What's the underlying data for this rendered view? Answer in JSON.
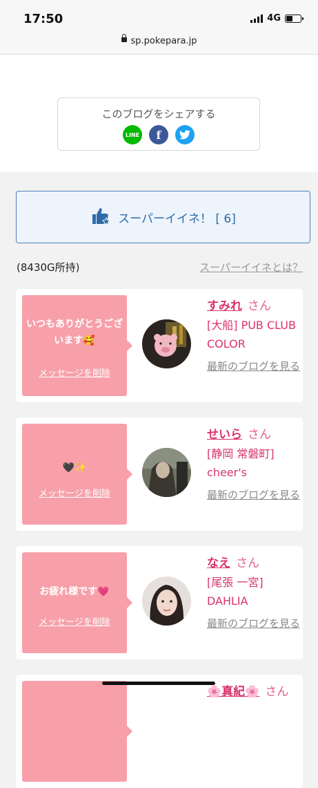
{
  "status_bar": {
    "time": "17:50",
    "network": "4G"
  },
  "url_bar": {
    "url": "sp.pokepara.jp"
  },
  "share": {
    "title": "このブログをシェアする",
    "line_label": "LINE",
    "facebook_label": "f"
  },
  "super_iine": {
    "label": "スーパーイイネ！ [ 6]",
    "owned": "(8430G所持)",
    "what_link": "スーパーイイネとは？"
  },
  "cards": [
    {
      "message": "いつもありがとうございます🥰",
      "delete_label": "メッセージを削除",
      "name": "すみれ",
      "suffix": "さん",
      "shop": "[大船] PUB CLUB COLOR",
      "latest_link": "最新のブログを見る"
    },
    {
      "message": "🖤✨",
      "delete_label": "メッセージを削除",
      "name": "せいら",
      "suffix": "さん",
      "shop": "[静岡 常磐町] cheer's",
      "latest_link": "最新のブログを見る"
    },
    {
      "message": "お疲れ様です💗",
      "delete_label": "メッセージを削除",
      "name": "なえ",
      "suffix": "さん",
      "shop": "[尾張 一宮] DAHLIA",
      "latest_link": "最新のブログを見る"
    },
    {
      "name": "🌸真紀🌸",
      "suffix": "さん"
    }
  ],
  "colors": {
    "pink": "#f7a0aa",
    "name": "#d9336b",
    "accent_blue": "#2d6ca8"
  }
}
